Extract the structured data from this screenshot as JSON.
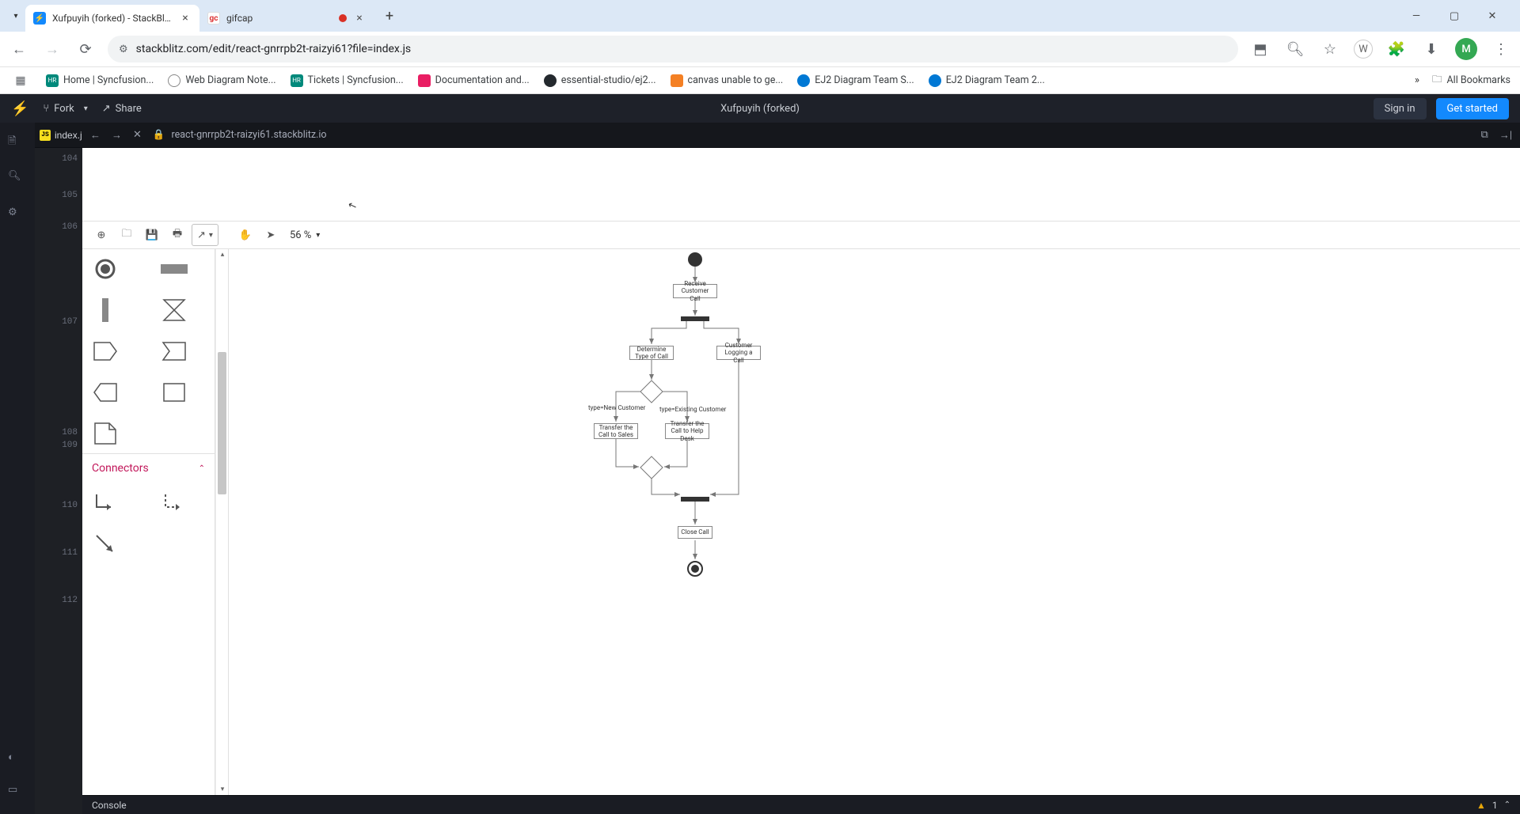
{
  "browser": {
    "tabs": [
      {
        "title": "Xufpuyih (forked) - StackBlitz",
        "active": true
      },
      {
        "title": "gifcap",
        "active": false
      }
    ],
    "url": "stackblitz.com/edit/react-gnrrpb2t-raizyi61?file=index.js",
    "bookmarks": [
      "Home | Syncfusion...",
      "Web Diagram Note...",
      "Tickets | Syncfusion...",
      "Documentation and...",
      "essential-studio/ej2...",
      "canvas unable to ge...",
      "EJ2 Diagram Team S...",
      "EJ2 Diagram Team 2..."
    ],
    "all_bookmarks": "All Bookmarks",
    "avatar": "M"
  },
  "stackblitz": {
    "fork": "Fork",
    "share": "Share",
    "project_title": "Xufpuyih (forked)",
    "signin": "Sign in",
    "get_started": "Get started",
    "file_tab": "index.j",
    "preview_url": "react-gnrrpb2t-raizyi61.stackblitz.io",
    "line_numbers": [
      "104",
      "105",
      "106",
      "107",
      "108",
      "109",
      "110",
      "111",
      "112"
    ],
    "console": "Console",
    "warning_count": "1"
  },
  "app": {
    "zoom": "56 %",
    "palette_header": "Connectors"
  },
  "diagram": {
    "nodes": {
      "receive": "Receive Customer Call",
      "determine": "Determine Type of Call",
      "logging": "Customer Logging a Call",
      "label_new": "type=New Customer",
      "label_existing": "type=Existing Customer",
      "transfer_sales": "Transfer the Call to Sales",
      "transfer_help": "Transfer the Call to Help Desk",
      "close": "Close Call"
    }
  }
}
